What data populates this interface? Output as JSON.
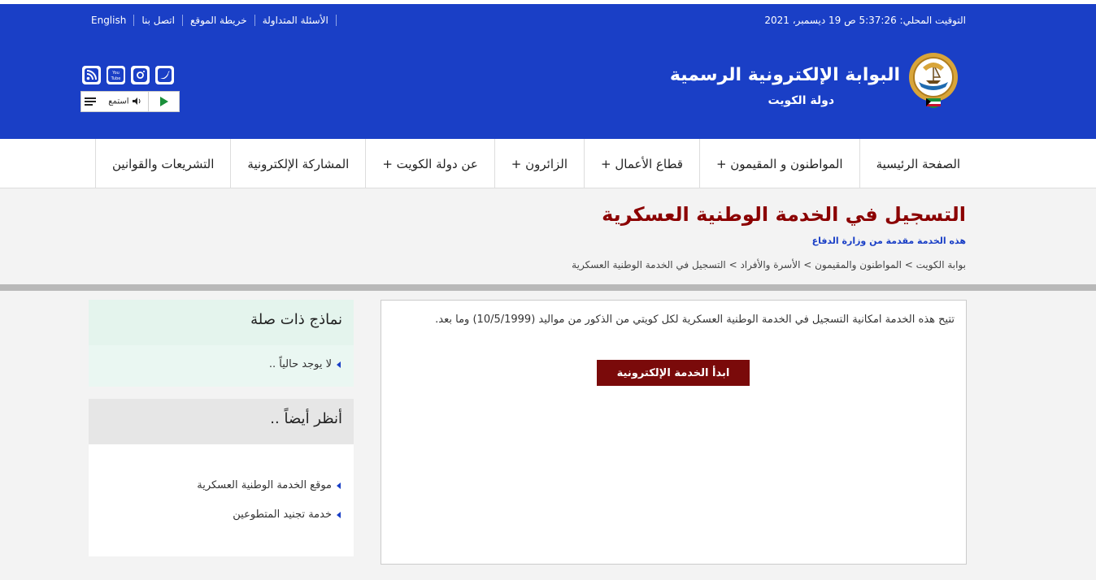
{
  "topbar": {
    "links": [
      "English",
      "اتصل بنا",
      "خريطة الموقع",
      "الأسئلة المتداولة"
    ],
    "clock": "التوقيت المحلي: 5:37:26 ص 19 ديسمبر، 2021"
  },
  "header": {
    "title": "البوابة الإلكترونية الرسمية",
    "subtitle": "دولة  الكويت",
    "listen_label": "استمع",
    "social_icons": [
      "rss-icon",
      "youtube-icon",
      "instagram-icon",
      "twitter-icon"
    ]
  },
  "nav": {
    "items": [
      "الصفحة الرئيسية",
      "المواطنون و المقيمون +",
      "قطاع الأعمال +",
      "الزائرون +",
      "عن دولة الكويت +",
      "المشاركة الإلكترونية",
      "التشريعات والقوانين"
    ]
  },
  "page": {
    "title": "التسجيل في الخدمة الوطنية العسكرية",
    "provider": "هذه الخدمة مقدمة من وزارة الدفاع",
    "breadcrumb": "بوابة الكويت > المواطنون والمقيمون > الأسرة والأفراد > التسجيل في الخدمة الوطنية العسكرية"
  },
  "content": {
    "description": "تتيح هذه الخدمة امكانية التسجيل في الخدمة الوطنية العسكرية لكل كويتي من الذكور من مواليد (10/5/1999) وما بعد.",
    "start_button": "ابدأ الخدمة الإلكترونية"
  },
  "sidebar": {
    "forms_title": "نماذج ذات صلة",
    "forms_empty": "لا يوجد حالياً ..",
    "see_also_title": "أنظر أيضاً ..",
    "see_also_items": [
      "موقع الخدمة الوطنية العسكرية",
      "خدمة تجنيد المتطوعين"
    ]
  },
  "colors": {
    "brand_blue": "#1a3fc6",
    "title_red": "#8b0000",
    "button_red": "#7a0a0a"
  }
}
